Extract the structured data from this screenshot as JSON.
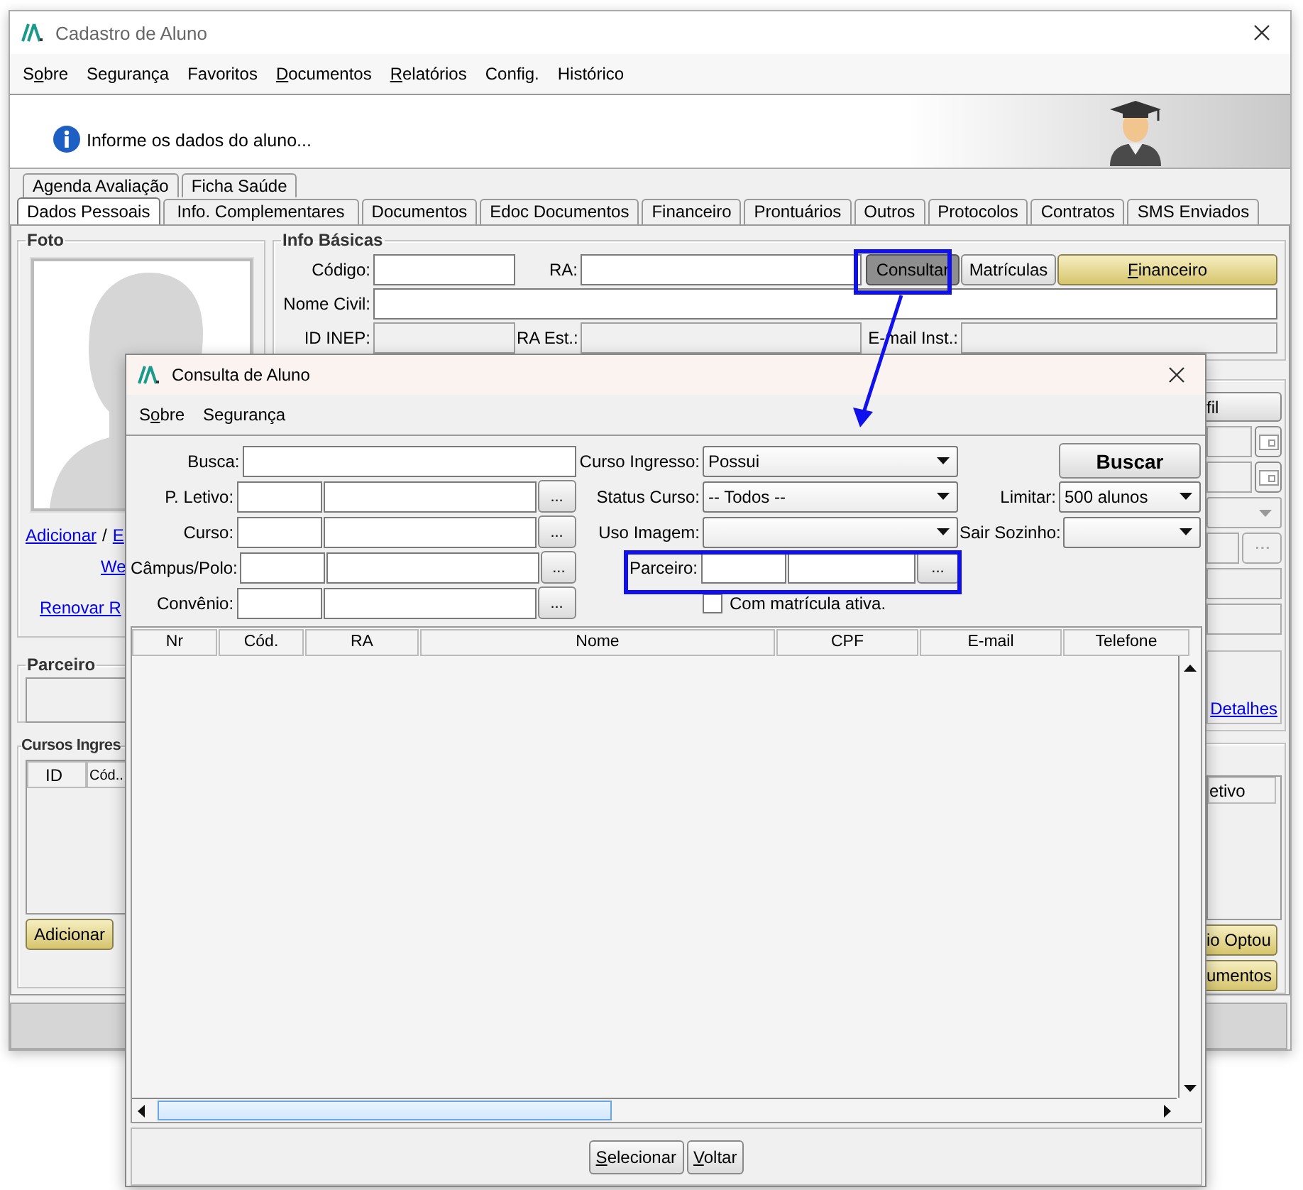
{
  "window": {
    "title": "Cadastro de Aluno"
  },
  "menu": [
    {
      "pre": "S",
      "key": "o",
      "post": "bre"
    },
    {
      "label": "Segurança"
    },
    {
      "label": "Favoritos"
    },
    {
      "key": "D",
      "post": "ocumentos"
    },
    {
      "key": "R",
      "post": "elatórios"
    },
    {
      "label": "Config."
    },
    {
      "label": "Histórico"
    }
  ],
  "banner": {
    "message": "Informe os dados do aluno..."
  },
  "tab_rows": [
    [
      {
        "label": "Agenda Avaliação",
        "selected": false
      },
      {
        "label": "Ficha Saúde",
        "selected": false
      }
    ],
    [
      {
        "label": "Dados Pessoais",
        "selected": true
      },
      {
        "label": "Info. Complementares",
        "selected": false
      },
      {
        "label": "Documentos",
        "selected": false
      },
      {
        "label": "Edoc Documentos",
        "selected": false
      },
      {
        "label": "Financeiro",
        "selected": false
      },
      {
        "label": "Prontuários",
        "selected": false
      },
      {
        "label": "Outros",
        "selected": false
      },
      {
        "label": "Protocolos",
        "selected": false
      },
      {
        "label": "Contratos",
        "selected": false
      },
      {
        "label": "SMS Enviados",
        "selected": false
      }
    ]
  ],
  "photo": {
    "title": "Foto",
    "link_add": "Adicionar",
    "separator": "/",
    "link_edit": "E",
    "link_web": "We",
    "link_renew": "Renovar R"
  },
  "partner": {
    "title": "Parceiro"
  },
  "courses": {
    "title": "Cursos Ingres",
    "columns": [
      "ID",
      "Cód.."
    ],
    "button": "Adicionar"
  },
  "info": {
    "title": "Info Básicas",
    "code": {
      "label": "Código:",
      "disabled": false
    },
    "ra": {
      "label": "RA:",
      "disabled": false
    },
    "buttons": [
      {
        "label": "Consultar",
        "kind": "pressed"
      },
      {
        "label": "Matrículas",
        "kind": "normal"
      },
      {
        "key": "F",
        "post": "inanceiro",
        "kind": "accent"
      }
    ],
    "name": {
      "label": "Nome Civil:",
      "disabled": false
    },
    "inep": {
      "label": "ID INEP:",
      "disabled": true
    },
    "ra_est": {
      "label": "RA Est.:",
      "disabled": true
    },
    "email": {
      "label": "E-mail Inst.:",
      "disabled": true
    }
  },
  "right_strip": {
    "profile_button": "fil",
    "details_link": "Detalhes",
    "table_column": "etivo",
    "buttons": [
      "io Optou",
      "umentos"
    ]
  },
  "dialog": {
    "title": "Consulta de Aluno",
    "menu": [
      {
        "pre": "S",
        "key": "o",
        "post": "bre"
      },
      {
        "label": "Segurança"
      }
    ],
    "left_fields": [
      {
        "label": "Busca:",
        "kind": "text"
      },
      {
        "label": "P. Letivo:",
        "kind": "lookup",
        "button": "..."
      },
      {
        "label": "Curso:",
        "kind": "lookup",
        "button": "..."
      },
      {
        "label": "Câmpus/Polo:",
        "kind": "lookup",
        "button": "..."
      },
      {
        "label": "Convênio:",
        "kind": "lookup",
        "button": "..."
      }
    ],
    "middle_fields": [
      {
        "label": "Curso Ingresso:",
        "kind": "select",
        "value": "Possui"
      },
      {
        "label": "Status Curso:",
        "kind": "select",
        "value": "-- Todos --"
      },
      {
        "label": "Uso Imagem:",
        "kind": "select"
      },
      {
        "label": "Parceiro:",
        "kind": "lookup",
        "button": "..."
      }
    ],
    "checkbox": {
      "label": "Com matrícula ativa.",
      "checked": false
    },
    "search_button": "Buscar",
    "right_fields": [
      {
        "label": "Limitar:",
        "value": "500 alunos"
      },
      {
        "label": "Sair Sozinho:"
      }
    ],
    "columns": [
      "Nr",
      "Cód.",
      "RA",
      "Nome",
      "CPF",
      "E-mail",
      "Telefone"
    ],
    "buttons": [
      {
        "key": "S",
        "post": "elecionar"
      },
      {
        "key": "V",
        "post": "oltar"
      }
    ]
  }
}
